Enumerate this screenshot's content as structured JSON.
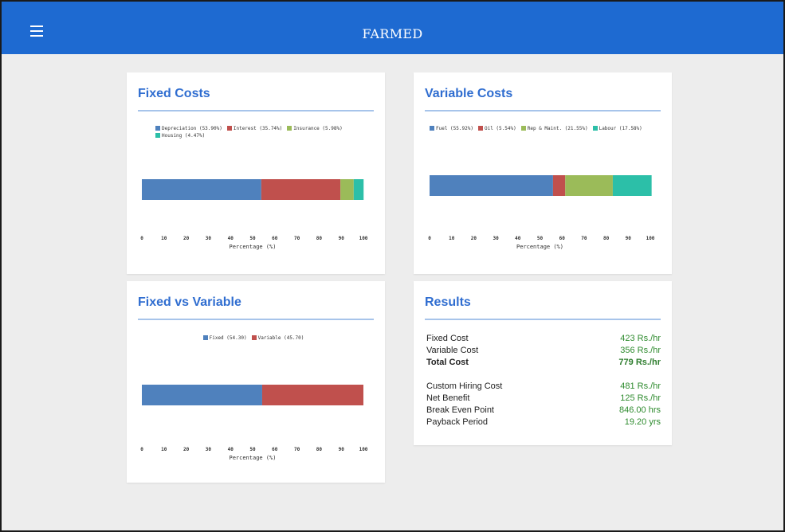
{
  "app": {
    "title": "FARMED",
    "menu_icon": "hamburger-menu-icon",
    "brand_color": "#1e6ad1"
  },
  "fixed_costs": {
    "title": "Fixed Costs",
    "legend": [
      {
        "label": "Depreciation (53.90%)",
        "color": "#4f81bd"
      },
      {
        "label": "Interest (35.74%)",
        "color": "#c0504d"
      },
      {
        "label": "Insurance (5.98%)",
        "color": "#9bbb59"
      },
      {
        "label": "Housing (4.47%)",
        "color": "#2cbfa8"
      }
    ]
  },
  "variable_costs": {
    "title": "Variable Costs",
    "legend": [
      {
        "label": "Fuel (55.92%)",
        "color": "#4f81bd"
      },
      {
        "label": "Oil (5.54%)",
        "color": "#c0504d"
      },
      {
        "label": "Rep & Maint. (21.55%)",
        "color": "#9bbb59"
      },
      {
        "label": "Labour (17.58%)",
        "color": "#2cbfa8"
      }
    ]
  },
  "fixed_vs_variable": {
    "title": "Fixed vs Variable",
    "legend": [
      {
        "label": "Fixed (54.30)",
        "color": "#4f81bd"
      },
      {
        "label": "Variable (45.70)",
        "color": "#c0504d"
      }
    ]
  },
  "results": {
    "title": "Results",
    "rows": [
      {
        "label": "Fixed Cost",
        "value": "423 Rs./hr"
      },
      {
        "label": "Variable Cost",
        "value": "356 Rs./hr"
      },
      {
        "label": "Total Cost",
        "value": "779 Rs./hr"
      },
      {
        "label": "Custom Hiring Cost",
        "value": "481 Rs./hr"
      },
      {
        "label": "Net Benefit",
        "value": "125 Rs./hr"
      },
      {
        "label": "Break Even Point",
        "value": "846.00 hrs"
      },
      {
        "label": "Payback Period",
        "value": "19.20 yrs"
      }
    ]
  },
  "chart_data": [
    {
      "type": "bar",
      "orientation": "horizontal-stacked",
      "title": "Fixed Costs",
      "xlabel": "Percentage (%)",
      "xlim": [
        0,
        100
      ],
      "xticks": [
        "0",
        "10",
        "20",
        "30",
        "40",
        "50",
        "60",
        "70",
        "80",
        "90",
        "100"
      ],
      "series": [
        {
          "name": "Depreciation (53.90%)",
          "values": [
            53.9
          ],
          "color": "#4f81bd"
        },
        {
          "name": "Interest (35.74%)",
          "values": [
            35.74
          ],
          "color": "#c0504d"
        },
        {
          "name": "Insurance (5.98%)",
          "values": [
            5.98
          ],
          "color": "#9bbb59"
        },
        {
          "name": "Housing (4.47%)",
          "values": [
            4.47
          ],
          "color": "#2cbfa8"
        }
      ],
      "grid": false,
      "legend": "top"
    },
    {
      "type": "bar",
      "orientation": "horizontal-stacked",
      "title": "Variable Costs",
      "xlabel": "Percentage (%)",
      "xlim": [
        0,
        100
      ],
      "xticks": [
        "0",
        "10",
        "20",
        "30",
        "40",
        "50",
        "60",
        "70",
        "80",
        "90",
        "100"
      ],
      "series": [
        {
          "name": "Fuel (55.92%)",
          "values": [
            55.92
          ],
          "color": "#4f81bd"
        },
        {
          "name": "Oil (5.54%)",
          "values": [
            5.54
          ],
          "color": "#c0504d"
        },
        {
          "name": "Rep & Maint. (21.55%)",
          "values": [
            21.55
          ],
          "color": "#9bbb59"
        },
        {
          "name": "Labour (17.58%)",
          "values": [
            17.58
          ],
          "color": "#2cbfa8"
        }
      ],
      "grid": false,
      "legend": "top"
    },
    {
      "type": "bar",
      "orientation": "horizontal-stacked",
      "title": "Fixed vs Variable",
      "xlabel": "Percentage (%)",
      "xlim": [
        0,
        100
      ],
      "xticks": [
        "0",
        "10",
        "20",
        "30",
        "40",
        "50",
        "60",
        "70",
        "80",
        "90",
        "100"
      ],
      "series": [
        {
          "name": "Fixed (54.30)",
          "values": [
            54.3
          ],
          "color": "#4f81bd"
        },
        {
          "name": "Variable (45.70)",
          "values": [
            45.7
          ],
          "color": "#c0504d"
        }
      ],
      "grid": false,
      "legend": "top"
    }
  ]
}
